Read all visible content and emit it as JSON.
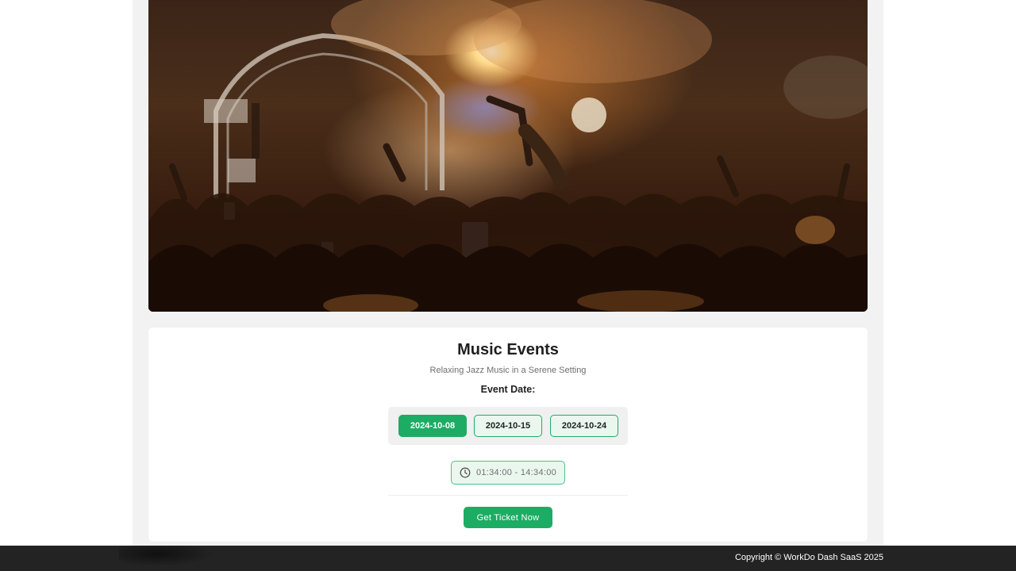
{
  "event": {
    "title": "Music Events",
    "subtitle": "Relaxing Jazz Music in a Serene Setting",
    "date_label": "Event Date:",
    "dates": [
      "2024-10-08",
      "2024-10-15",
      "2024-10-24"
    ],
    "selected_date": "2024-10-08",
    "time_range": "01:34:00 - 14:34:00",
    "ticket_label": "Get Ticket Now"
  },
  "hero": {
    "image": "concert-crowd-photo"
  },
  "footer": {
    "copyright": "Copyright © WorkDo Dash SaaS 2025"
  },
  "colors": {
    "accent": "#1dac64",
    "accent_light": "#eaf7ef",
    "footer_bg": "#232323",
    "page_bg": "#f2f2f2"
  },
  "icons": {
    "time": "clock-icon"
  }
}
